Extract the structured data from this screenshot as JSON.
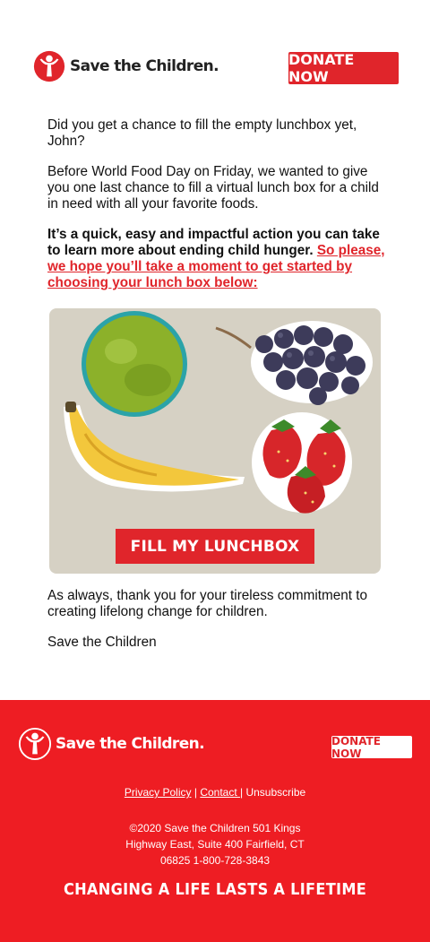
{
  "brand": {
    "name": "Save the Children.",
    "color": "#e0252b"
  },
  "header": {
    "donate_label": "DONATE NOW"
  },
  "body": {
    "p1": "Did you get a chance to fill the empty lunchbox yet, John?",
    "p2": "Before World Food Day on Friday, we wanted to give you one last chance to fill a virtual lunch box for a child in need with all your favorite foods.",
    "p3_bold": "It’s a quick, easy and impactful action you can take to learn more about ending child hunger.",
    "p3_link": "So please, we hope you’ll take a moment to get started by choosing your lunch box below:"
  },
  "hero": {
    "items": [
      "apple",
      "grapes",
      "banana",
      "strawberries"
    ],
    "button_label": "FILL MY LUNCHBOX"
  },
  "closing": {
    "p1": "As always, thank you for your tireless commitment to creating lifelong change for children.",
    "signoff": "Save the Children"
  },
  "footer": {
    "donate_label": "DONATE NOW",
    "privacy": "Privacy Policy",
    "sep1": " | ",
    "contact": "Contact ",
    "sep2": "| ",
    "unsubscribe": "Unsubscribe",
    "address_line1": "©2020 Save the Children 501 Kings",
    "address_line2": "Highway East, Suite 400 Fairfield, CT",
    "address_line3": "06825 1-800-728-3843",
    "tagline": "CHANGING A LIFE LASTS A LIFETIME"
  }
}
